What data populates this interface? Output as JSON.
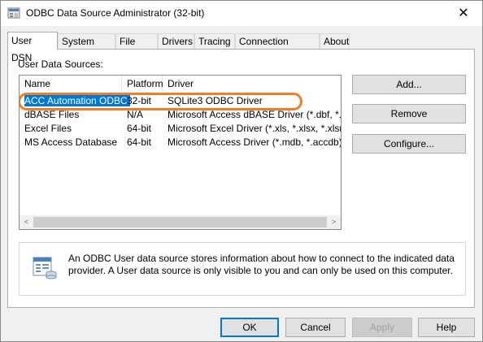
{
  "window": {
    "title": "ODBC Data Source Administrator (32-bit)",
    "close_glyph": "✕"
  },
  "tabs": [
    {
      "label": "User DSN",
      "active": true
    },
    {
      "label": "System DSN"
    },
    {
      "label": "File DSN"
    },
    {
      "label": "Drivers"
    },
    {
      "label": "Tracing"
    },
    {
      "label": "Connection Pooling"
    },
    {
      "label": "About"
    }
  ],
  "user_dsn": {
    "section_label": "User Data Sources:",
    "columns": [
      "Name",
      "Platform",
      "Driver"
    ],
    "rows": [
      {
        "name": "ACC Automation ODBC",
        "platform": "32-bit",
        "driver": "SQLite3 ODBC Driver",
        "selected": true
      },
      {
        "name": "dBASE Files",
        "platform": "N/A",
        "driver": "Microsoft Access dBASE Driver (*.dbf, *.ndx,"
      },
      {
        "name": "Excel Files",
        "platform": "64-bit",
        "driver": "Microsoft Excel Driver (*.xls, *.xlsx, *.xlsm, *.xl"
      },
      {
        "name": "MS Access Database",
        "platform": "64-bit",
        "driver": "Microsoft Access Driver (*.mdb, *.accdb)"
      }
    ],
    "scroll_left_glyph": "<",
    "scroll_right_glyph": ">",
    "buttons": {
      "add": "Add...",
      "remove": "Remove",
      "configure": "Configure..."
    },
    "info_text": "An ODBC User data source stores information about how to connect to the indicated data provider.   A User data source is only visible to you and can only be used on this computer.",
    "info_icon": "database-info-icon"
  },
  "footer": {
    "ok": "OK",
    "cancel": "Cancel",
    "apply": "Apply",
    "help": "Help"
  },
  "colors": {
    "selection": "#0078d7",
    "annotation_oval": "#f07e27",
    "default_button_border": "#0078d7"
  }
}
